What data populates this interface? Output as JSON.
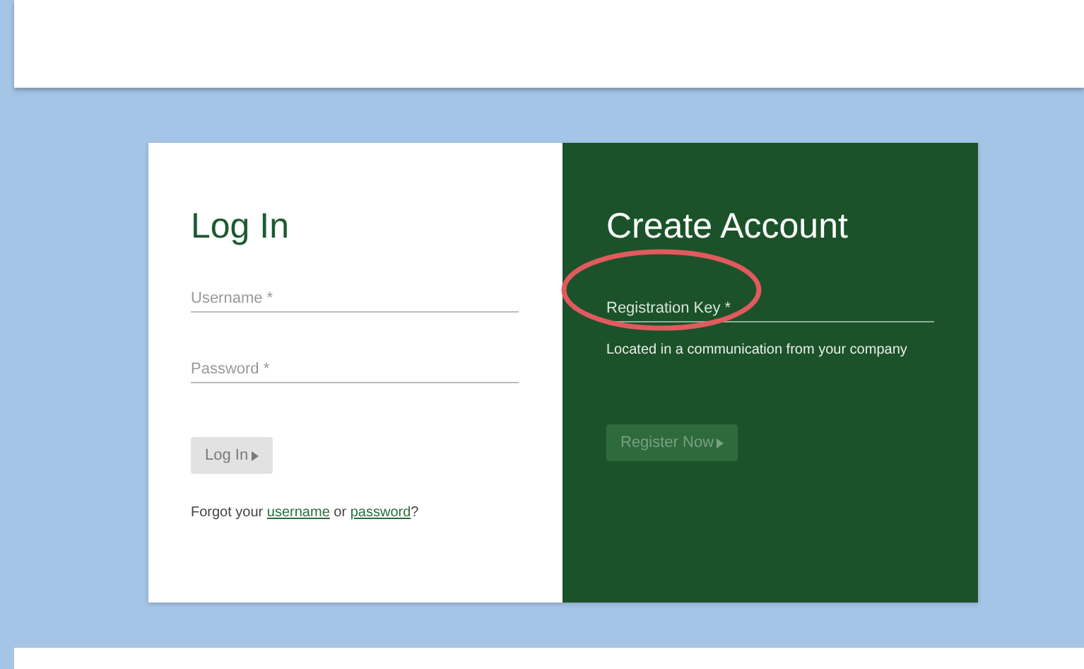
{
  "login": {
    "title": "Log In",
    "fields": [
      {
        "placeholder": "Username *"
      },
      {
        "placeholder": "Password *"
      }
    ],
    "button": {
      "label": "Log In",
      "disabled": true
    },
    "forgot": {
      "prefix": "Forgot your ",
      "link_1": "username",
      "middle": " or ",
      "link_2": "password",
      "suffix": "?"
    }
  },
  "register": {
    "title": "Create Account",
    "field": {
      "placeholder": "Registration Key *"
    },
    "hint": "Located in a communication from your company",
    "button": {
      "label": "Register Now",
      "disabled": true
    },
    "highlight": {
      "kind": "circle"
    }
  }
}
